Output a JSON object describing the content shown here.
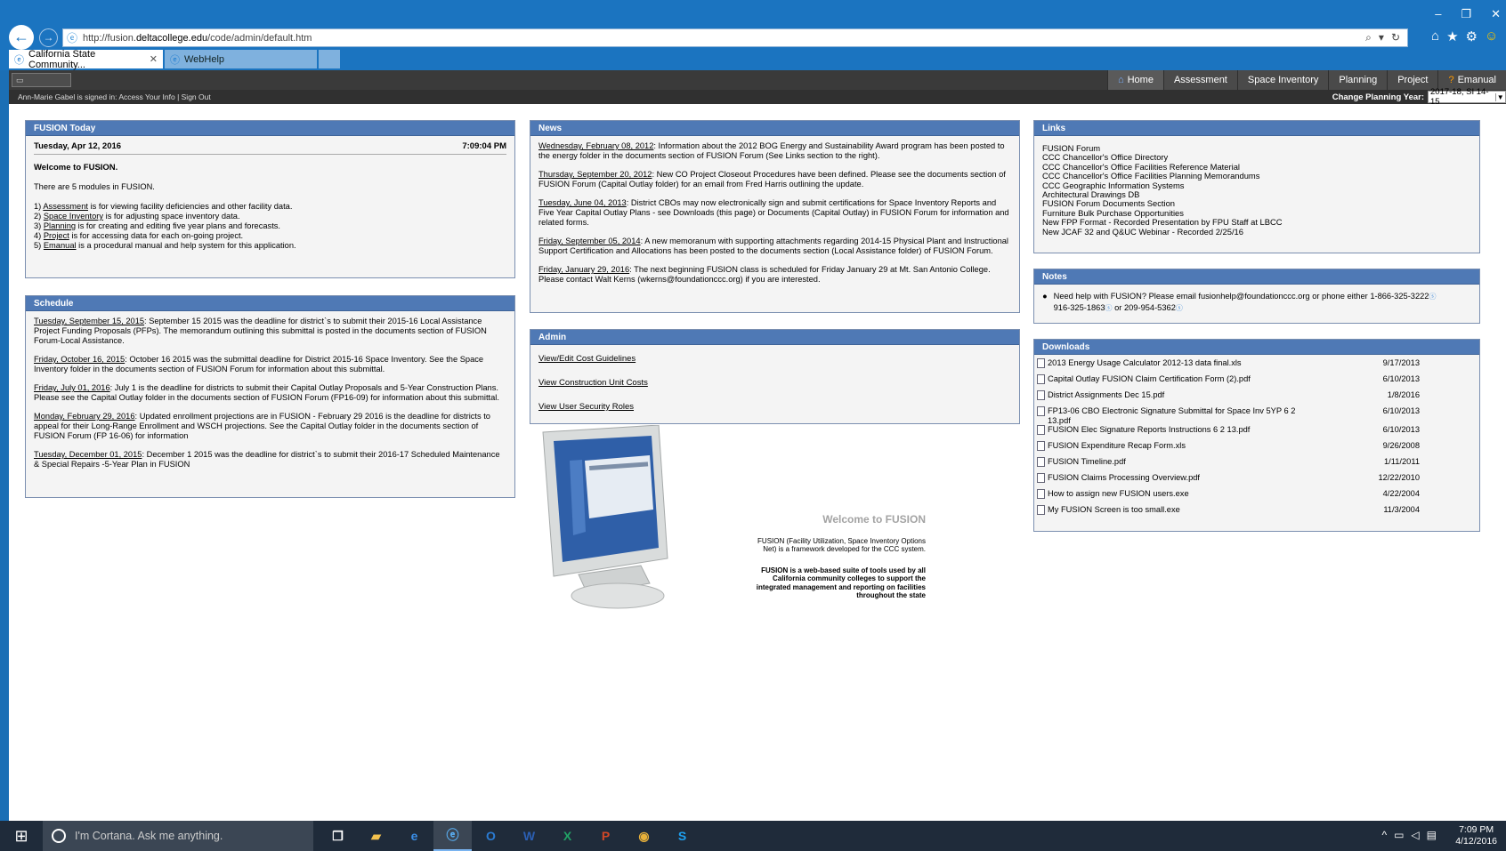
{
  "browser": {
    "url_prefix": "http://fusion.",
    "url_domain": "deltacollege.edu",
    "url_path": "/code/admin/default.htm",
    "tabs": [
      {
        "label": "California State Community..."
      },
      {
        "label": "WebHelp"
      }
    ]
  },
  "nav": {
    "items": [
      "Home",
      "Assessment",
      "Space Inventory",
      "Planning",
      "Project",
      "Emanual"
    ]
  },
  "userbar": {
    "signed_in": "Ann-Marie Gabel is signed in: Access Your Info | Sign Out",
    "plan_label": "Change Planning Year:",
    "plan_value": "2017-18, SI 14-15"
  },
  "today": {
    "title": "FUSION Today",
    "date": "Tuesday, Apr 12, 2016",
    "time": "7:09:04 PM",
    "welcome": "Welcome to FUSION.",
    "intro": "There are 5 modules in FUSION.",
    "modules": [
      {
        "num": "1) ",
        "name": "Assessment",
        "desc": " is for viewing facility deficiencies and other facility data."
      },
      {
        "num": "2) ",
        "name": "Space Inventory",
        "desc": " is for adjusting space inventory data."
      },
      {
        "num": "3) ",
        "name": "Planning",
        "desc": " is for creating and editing five year plans and forecasts."
      },
      {
        "num": "4) ",
        "name": "Project",
        "desc": " is for accessing data for each on-going project."
      },
      {
        "num": "5) ",
        "name": "Emanual",
        "desc": " is a procedural manual and help system for this application."
      }
    ]
  },
  "schedule": {
    "title": "Schedule",
    "items": [
      {
        "date": "Tuesday, September 15, 2015",
        "text": ":  September 15 2015 was the deadline for district`s to submit their 2015-16 Local Assistance Project Funding Proposals (PFPs). The memorandum outlining this submittal is posted in the documents section of FUSION Forum-Local Assistance."
      },
      {
        "date": "Friday, October 16, 2015",
        "text": ":  October 16 2015 was the submittal deadline for District 2015-16 Space Inventory. See the Space Inventory folder in the documents section of FUSION Forum for information about this submittal."
      },
      {
        "date": "Friday, July 01, 2016",
        "text": ":  July 1 is the deadline for districts to submit their Capital Outlay Proposals and 5-Year Construction Plans. Please see the Capital Outlay folder in the documents section of FUSION Forum (FP16-09) for information about this submittal."
      },
      {
        "date": "Monday, February 29, 2016",
        "text": ":  Updated enrollment projections are in FUSION - February 29 2016 is the deadline for districts to appeal for their Long-Range Enrollment and WSCH projections. See the Capital Outlay folder in the documents section of FUSION Forum (FP 16-06) for information"
      },
      {
        "date": "Tuesday, December 01, 2015",
        "text": ":  December 1 2015 was the deadline for district`s to submit their 2016-17 Scheduled Maintenance & Special Repairs -5-Year Plan in FUSION"
      }
    ]
  },
  "news": {
    "title": "News",
    "items": [
      {
        "date": "Wednesday, February 08, 2012",
        "text": ":  Information about the 2012 BOG Energy and Sustainability Award program has been posted to the energy folder in the documents section of FUSION Forum (See Links section to the right)."
      },
      {
        "date": "Thursday, September 20, 2012",
        "text": ":  New CO Project Closeout Procedures have been defined. Please see the documents section of FUSION Forum (Capital Outlay folder) for an email from Fred Harris outlining the update."
      },
      {
        "date": "Tuesday, June 04, 2013",
        "text": ":  District CBOs may now electronically sign and submit certifications for Space Inventory Reports and Five Year Capital Outlay Plans - see Downloads (this page) or Documents (Capital Outlay) in FUSION Forum for information and related forms."
      },
      {
        "date": "Friday, September 05, 2014",
        "text": ":  A new memoranum with supporting attachments regarding 2014-15 Physical Plant and Instructional Support Certification and Allocations has been posted to the documents section (Local Assistance folder) of FUSION Forum."
      },
      {
        "date": "Friday, January 29, 2016",
        "text": ":  The next beginning FUSION class is scheduled for Friday January 29 at Mt. San Antonio College. Please contact Walt Kerns (wkerns@foundationccc.org) if you are interested."
      }
    ]
  },
  "admin": {
    "title": "Admin",
    "links": [
      "View/Edit Cost Guidelines",
      "View Construction Unit Costs",
      "View User Security Roles"
    ]
  },
  "welcome_block": {
    "title": "Welcome to FUSION",
    "p1": "FUSION (Facility Utilization, Space Inventory Options Net) is a framework developed for the CCC system.",
    "p2": "FUSION is a web-based suite of tools used by all California community colleges to support the integrated management and reporting on facilities throughout the state"
  },
  "links": {
    "title": "Links",
    "items": [
      "FUSION Forum",
      "CCC Chancellor's Office Directory",
      "CCC Chancellor's Office Facilities Reference Material",
      "CCC Chancellor's Office Facilities Planning Memorandums",
      "CCC Geographic Information Systems",
      "Architectural Drawings DB",
      "FUSION Forum Documents Section",
      "Furniture Bulk Purchase Opportunities",
      "New FPP Format - Recorded Presentation by FPU Staff at LBCC",
      "New JCAF 32 and Q&UC Webinar - Recorded 2/25/16"
    ]
  },
  "notes": {
    "title": "Notes",
    "line1": "Need help with FUSION? Please email fusionhelp@foundationccc.org or phone either 1-866-325-3222",
    "line2a": "916-325-1863",
    "line2b": " or 209-954-5362"
  },
  "downloads": {
    "title": "Downloads",
    "items": [
      {
        "name": "2013 Energy Usage Calculator 2012-13 data final.xls",
        "date": "9/17/2013"
      },
      {
        "name": "Capital Outlay FUSION Claim Certification Form (2).pdf",
        "date": "6/10/2013"
      },
      {
        "name": "District Assignments Dec 15.pdf",
        "date": "1/8/2016"
      },
      {
        "name": "FP13-06 CBO Electronic Signature Submittal for Space Inv 5YP 6 2 13.pdf",
        "date": "6/10/2013"
      },
      {
        "name": "FUSION Elec Signature Reports Instructions 6 2 13.pdf",
        "date": "6/10/2013"
      },
      {
        "name": "FUSION Expenditure Recap Form.xls",
        "date": "9/26/2008"
      },
      {
        "name": "FUSION Timeline.pdf",
        "date": "1/11/2011"
      },
      {
        "name": "FUSION Claims Processing Overview.pdf",
        "date": "12/22/2010"
      },
      {
        "name": "How to assign new FUSION users.exe",
        "date": "4/22/2004"
      },
      {
        "name": "My FUSION Screen is too small.exe",
        "date": "11/3/2004"
      }
    ]
  },
  "taskbar": {
    "cortana": "I'm Cortana. Ask me anything.",
    "time": "7:09 PM",
    "date": "4/12/2016"
  }
}
